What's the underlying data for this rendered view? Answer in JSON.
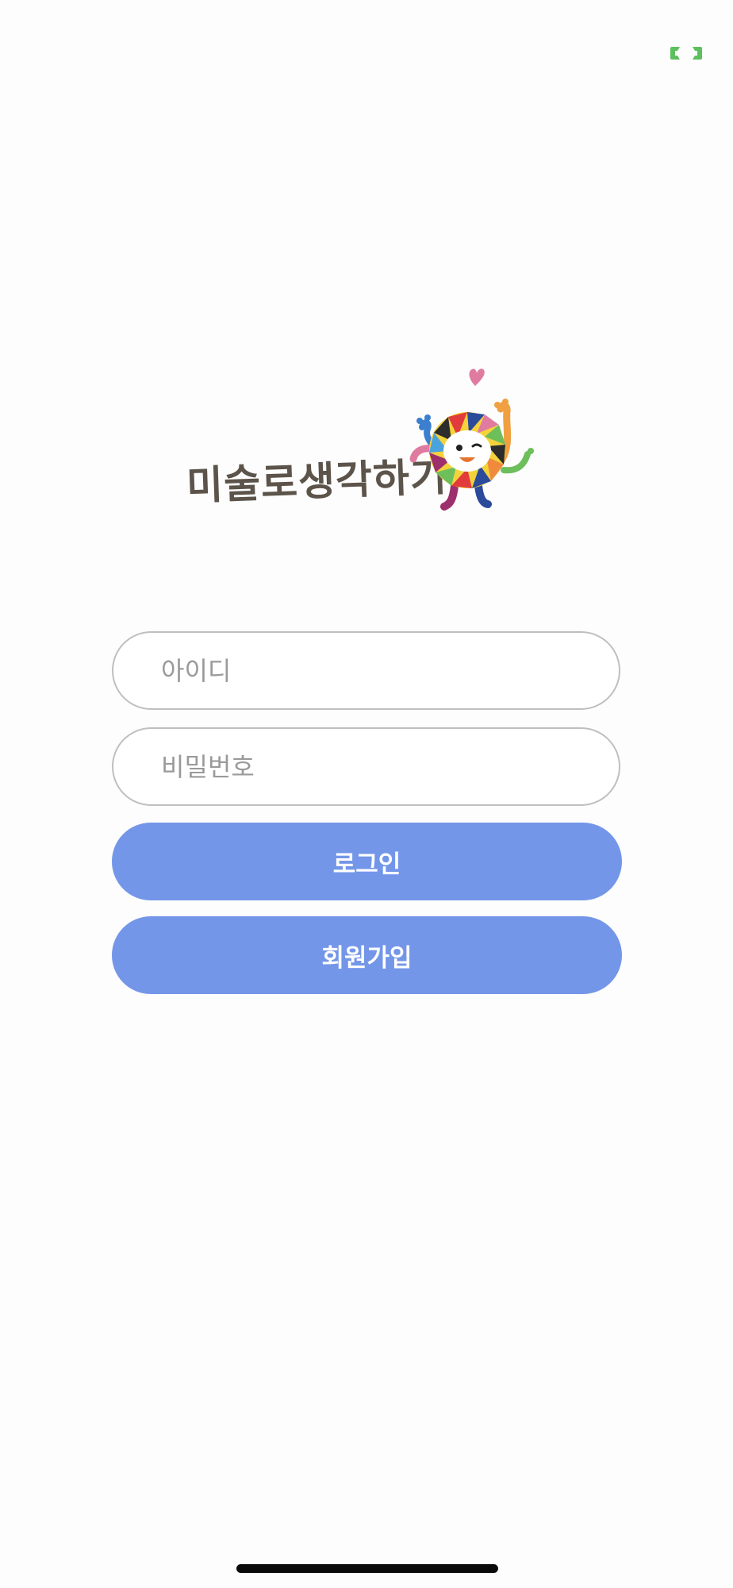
{
  "app": {
    "logo_text": "미술로생각하기"
  },
  "login_form": {
    "id_placeholder": "아이디",
    "password_placeholder": "비밀번호",
    "login_label": "로그인",
    "signup_label": "회원가입"
  },
  "icons": {
    "corner": "expand-brackets-icon",
    "mascot": "mascot-logo-icon"
  },
  "colors": {
    "accent_button": "#7396e8",
    "corner_icon": "#5cc05c",
    "logo_text": "#5c544a",
    "field_border": "#bfbfbf"
  }
}
